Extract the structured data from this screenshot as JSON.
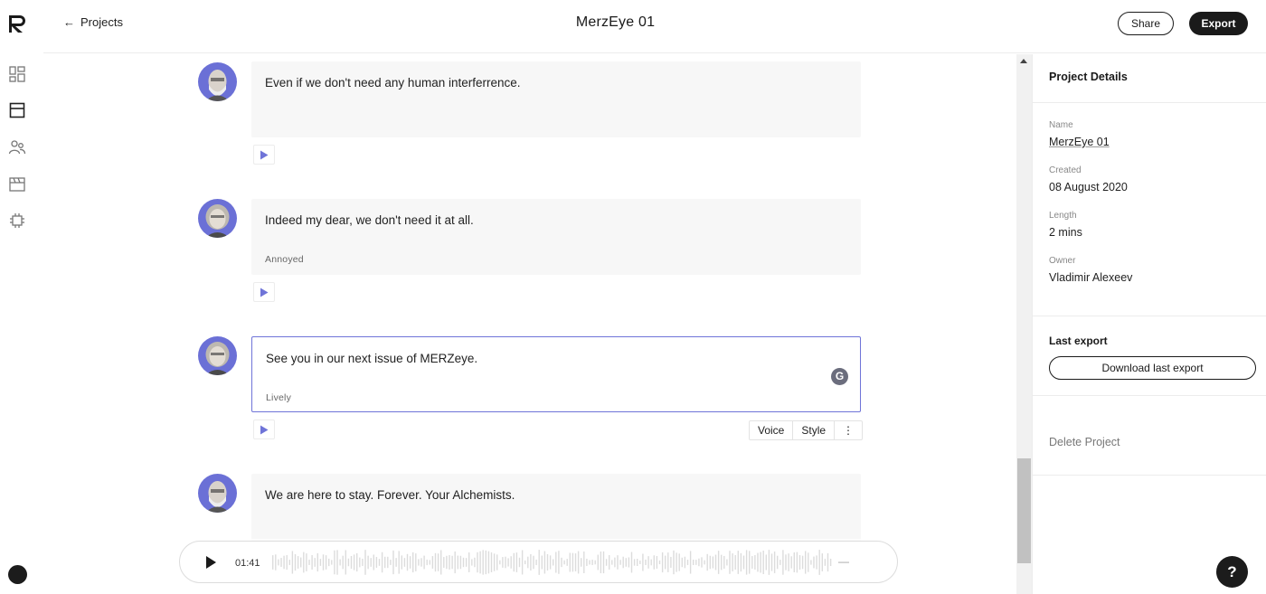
{
  "header": {
    "back_label": "Projects",
    "title": "MerzEye 01",
    "share_label": "Share",
    "export_label": "Export"
  },
  "rail": {
    "icons": [
      "dashboard-icon",
      "layout-icon",
      "users-icon",
      "clapperboard-icon",
      "chip-icon"
    ]
  },
  "messages": [
    {
      "text": "Even if we don't need any human interferrence.",
      "style": "",
      "active": false
    },
    {
      "text": "Indeed my dear, we don't need it at all.",
      "style": "Annoyed",
      "active": false
    },
    {
      "text": "See you in our next issue of MERZeye.",
      "style": "Lively",
      "active": true
    },
    {
      "text": "We are here to stay. Forever. Your Alchemists.",
      "style": "",
      "active": false
    }
  ],
  "toolbar": {
    "voice_label": "Voice",
    "style_label": "Style",
    "more_label": "⋮"
  },
  "player": {
    "time": "01:41"
  },
  "panel": {
    "title": "Project Details",
    "name_label": "Name",
    "name_value": "MerzEye 01",
    "created_label": "Created",
    "created_value": "08 August 2020",
    "length_label": "Length",
    "length_value": "2 mins",
    "owner_label": "Owner",
    "owner_value": "Vladimir Alexeev",
    "last_export_label": "Last export",
    "download_label": "Download last export",
    "delete_label": "Delete Project"
  },
  "help_label": "?",
  "colors": {
    "accent": "#6f74d8",
    "dark": "#1a1a1a",
    "bubble": "#f7f7f7"
  }
}
